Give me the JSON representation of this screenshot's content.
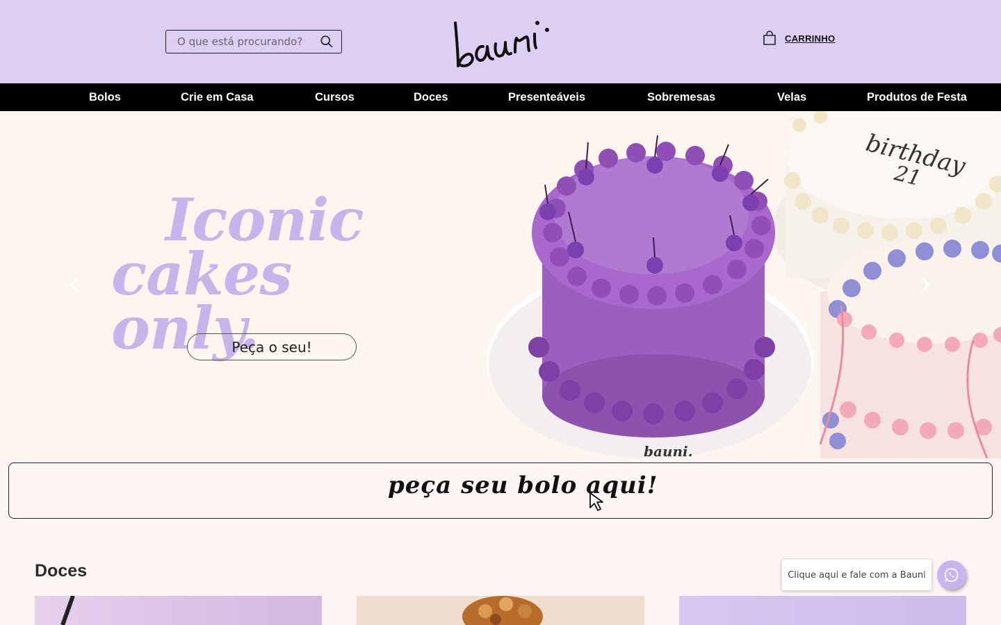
{
  "header": {
    "search_placeholder": "O que está procurando?",
    "logo_text": "bauni.",
    "cart_label": "CARRINHO"
  },
  "nav": {
    "items": [
      {
        "label": "Bolos"
      },
      {
        "label": "Crie em Casa"
      },
      {
        "label": "Cursos"
      },
      {
        "label": "Doces"
      },
      {
        "label": "Presenteáveis"
      },
      {
        "label": "Sobremesas"
      },
      {
        "label": "Velas"
      },
      {
        "label": "Produtos de Festa"
      }
    ]
  },
  "hero": {
    "title_line1": "Iconic",
    "title_line2": "cakes only.",
    "cta_label": "Peça o seu!",
    "cake_writing_line1": "birthday",
    "cake_writing_line2": "21",
    "cake_plate_brand": "bauni."
  },
  "order_banner": {
    "text": "peça seu bolo aqui!"
  },
  "section": {
    "title": "Doces"
  },
  "whatsapp": {
    "label": "Clique aqui e fale com a Bauni"
  },
  "colors": {
    "header_bg": "#dccff3",
    "nav_bg": "#000000",
    "accent_lilac": "#c8b4ea",
    "hero_bg": "#fdf6ee",
    "page_bg": "#fdf5f3"
  },
  "icons": {
    "search": "search-icon",
    "cart": "shopping-bag-icon",
    "whatsapp": "whatsapp-icon",
    "prev": "chevron-left-icon",
    "next": "chevron-right-icon"
  }
}
